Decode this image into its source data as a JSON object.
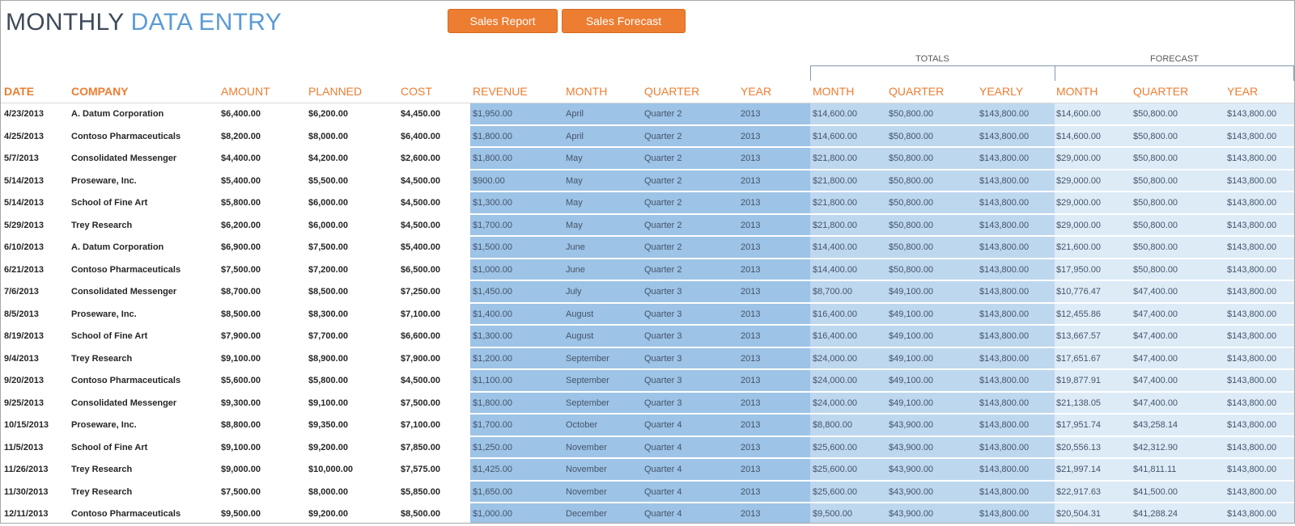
{
  "title": {
    "part1": "MONTHLY",
    "part2": "DATA ENTRY"
  },
  "buttons": {
    "sales_report": "Sales Report",
    "sales_forecast": "Sales Forecast"
  },
  "groups": {
    "totals": "TOTALS",
    "forecast": "FORECAST"
  },
  "columns": {
    "date": "DATE",
    "company": "COMPANY",
    "amount": "AMOUNT",
    "planned": "PLANNED",
    "cost": "COST",
    "revenue": "REVENUE",
    "month": "MONTH",
    "quarter": "QUARTER",
    "year": "YEAR",
    "tot_month": "MONTH",
    "tot_quarter": "QUARTER",
    "tot_yearly": "YEARLY",
    "fc_month": "MONTH",
    "fc_quarter": "QUARTER",
    "fc_year": "YEAR"
  },
  "colors": {
    "accent": "#ed7d31",
    "title_blue": "#5b9bd5",
    "band_revenue": "#9dc3e6",
    "band_totals": "#bdd7ee",
    "band_forecast": "#ddebf7"
  },
  "rows": [
    [
      "4/23/2013",
      "A. Datum Corporation",
      "$6,400.00",
      "$6,200.00",
      "$4,450.00",
      "$1,950.00",
      "April",
      "Quarter 2",
      "2013",
      "$14,600.00",
      "$50,800.00",
      "$143,800.00",
      "$14,600.00",
      "$50,800.00",
      "$143,800.00"
    ],
    [
      "4/25/2013",
      "Contoso Pharmaceuticals",
      "$8,200.00",
      "$8,000.00",
      "$6,400.00",
      "$1,800.00",
      "April",
      "Quarter 2",
      "2013",
      "$14,600.00",
      "$50,800.00",
      "$143,800.00",
      "$14,600.00",
      "$50,800.00",
      "$143,800.00"
    ],
    [
      "5/7/2013",
      "Consolidated Messenger",
      "$4,400.00",
      "$4,200.00",
      "$2,600.00",
      "$1,800.00",
      "May",
      "Quarter 2",
      "2013",
      "$21,800.00",
      "$50,800.00",
      "$143,800.00",
      "$29,000.00",
      "$50,800.00",
      "$143,800.00"
    ],
    [
      "5/14/2013",
      "Proseware, Inc.",
      "$5,400.00",
      "$5,500.00",
      "$4,500.00",
      "$900.00",
      "May",
      "Quarter 2",
      "2013",
      "$21,800.00",
      "$50,800.00",
      "$143,800.00",
      "$29,000.00",
      "$50,800.00",
      "$143,800.00"
    ],
    [
      "5/14/2013",
      "School of Fine Art",
      "$5,800.00",
      "$6,000.00",
      "$4,500.00",
      "$1,300.00",
      "May",
      "Quarter 2",
      "2013",
      "$21,800.00",
      "$50,800.00",
      "$143,800.00",
      "$29,000.00",
      "$50,800.00",
      "$143,800.00"
    ],
    [
      "5/29/2013",
      "Trey Research",
      "$6,200.00",
      "$6,000.00",
      "$4,500.00",
      "$1,700.00",
      "May",
      "Quarter 2",
      "2013",
      "$21,800.00",
      "$50,800.00",
      "$143,800.00",
      "$29,000.00",
      "$50,800.00",
      "$143,800.00"
    ],
    [
      "6/10/2013",
      "A. Datum Corporation",
      "$6,900.00",
      "$7,500.00",
      "$5,400.00",
      "$1,500.00",
      "June",
      "Quarter 2",
      "2013",
      "$14,400.00",
      "$50,800.00",
      "$143,800.00",
      "$21,600.00",
      "$50,800.00",
      "$143,800.00"
    ],
    [
      "6/21/2013",
      "Contoso Pharmaceuticals",
      "$7,500.00",
      "$7,200.00",
      "$6,500.00",
      "$1,000.00",
      "June",
      "Quarter 2",
      "2013",
      "$14,400.00",
      "$50,800.00",
      "$143,800.00",
      "$17,950.00",
      "$50,800.00",
      "$143,800.00"
    ],
    [
      "7/6/2013",
      "Consolidated Messenger",
      "$8,700.00",
      "$8,500.00",
      "$7,250.00",
      "$1,450.00",
      "July",
      "Quarter 3",
      "2013",
      "$8,700.00",
      "$49,100.00",
      "$143,800.00",
      "$10,776.47",
      "$47,400.00",
      "$143,800.00"
    ],
    [
      "8/5/2013",
      "Proseware, Inc.",
      "$8,500.00",
      "$8,300.00",
      "$7,100.00",
      "$1,400.00",
      "August",
      "Quarter 3",
      "2013",
      "$16,400.00",
      "$49,100.00",
      "$143,800.00",
      "$12,455.86",
      "$47,400.00",
      "$143,800.00"
    ],
    [
      "8/19/2013",
      "School of Fine Art",
      "$7,900.00",
      "$7,700.00",
      "$6,600.00",
      "$1,300.00",
      "August",
      "Quarter 3",
      "2013",
      "$16,400.00",
      "$49,100.00",
      "$143,800.00",
      "$13,667.57",
      "$47,400.00",
      "$143,800.00"
    ],
    [
      "9/4/2013",
      "Trey Research",
      "$9,100.00",
      "$8,900.00",
      "$7,900.00",
      "$1,200.00",
      "September",
      "Quarter 3",
      "2013",
      "$24,000.00",
      "$49,100.00",
      "$143,800.00",
      "$17,651.67",
      "$47,400.00",
      "$143,800.00"
    ],
    [
      "9/20/2013",
      "Contoso Pharmaceuticals",
      "$5,600.00",
      "$5,800.00",
      "$4,500.00",
      "$1,100.00",
      "September",
      "Quarter 3",
      "2013",
      "$24,000.00",
      "$49,100.00",
      "$143,800.00",
      "$19,877.91",
      "$47,400.00",
      "$143,800.00"
    ],
    [
      "9/25/2013",
      "Consolidated Messenger",
      "$9,300.00",
      "$9,100.00",
      "$7,500.00",
      "$1,800.00",
      "September",
      "Quarter 3",
      "2013",
      "$24,000.00",
      "$49,100.00",
      "$143,800.00",
      "$21,138.05",
      "$47,400.00",
      "$143,800.00"
    ],
    [
      "10/15/2013",
      "Proseware, Inc.",
      "$8,800.00",
      "$9,350.00",
      "$7,100.00",
      "$1,700.00",
      "October",
      "Quarter 4",
      "2013",
      "$8,800.00",
      "$43,900.00",
      "$143,800.00",
      "$17,951.74",
      "$43,258.14",
      "$143,800.00"
    ],
    [
      "11/5/2013",
      "School of Fine Art",
      "$9,100.00",
      "$9,200.00",
      "$7,850.00",
      "$1,250.00",
      "November",
      "Quarter 4",
      "2013",
      "$25,600.00",
      "$43,900.00",
      "$143,800.00",
      "$20,556.13",
      "$42,312.90",
      "$143,800.00"
    ],
    [
      "11/26/2013",
      "Trey Research",
      "$9,000.00",
      "$10,000.00",
      "$7,575.00",
      "$1,425.00",
      "November",
      "Quarter 4",
      "2013",
      "$25,600.00",
      "$43,900.00",
      "$143,800.00",
      "$21,997.14",
      "$41,811.11",
      "$143,800.00"
    ],
    [
      "11/30/2013",
      "Trey Research",
      "$7,500.00",
      "$8,000.00",
      "$5,850.00",
      "$1,650.00",
      "November",
      "Quarter 4",
      "2013",
      "$25,600.00",
      "$43,900.00",
      "$143,800.00",
      "$22,917.63",
      "$41,500.00",
      "$143,800.00"
    ],
    [
      "12/11/2013",
      "Contoso Pharmaceuticals",
      "$9,500.00",
      "$9,200.00",
      "$8,500.00",
      "$1,000.00",
      "December",
      "Quarter 4",
      "2013",
      "$9,500.00",
      "$43,900.00",
      "$143,800.00",
      "$20,504.31",
      "$41,288.24",
      "$143,800.00"
    ]
  ]
}
